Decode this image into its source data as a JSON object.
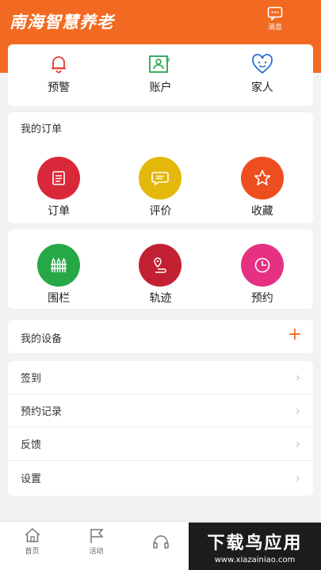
{
  "header": {
    "title": "南海智慧养老",
    "message_label": "消息",
    "message_icon": "chat-bubble-icon",
    "background": "#f26a22"
  },
  "top_actions": [
    {
      "label": "预警",
      "icon": "bell-icon",
      "color": "#e23b2e"
    },
    {
      "label": "账户",
      "icon": "account-card-icon",
      "color": "#27a54a"
    },
    {
      "label": "家人",
      "icon": "smile-heart-icon",
      "color": "#2b6fd6"
    }
  ],
  "orders": {
    "title": "我的订单",
    "items": [
      {
        "label": "订单",
        "icon": "order-list-icon",
        "color": "#d9283a"
      },
      {
        "label": "评价",
        "icon": "comment-icon",
        "color": "#e3b80b"
      },
      {
        "label": "收藏",
        "icon": "star-icon",
        "color": "#ee4d1f"
      }
    ]
  },
  "tools": {
    "items": [
      {
        "label": "围栏",
        "icon": "fence-icon",
        "color": "#27a847"
      },
      {
        "label": "轨迹",
        "icon": "track-icon",
        "color": "#c22033"
      },
      {
        "label": "预约",
        "icon": "clock-icon",
        "color": "#e63183"
      }
    ]
  },
  "device": {
    "title": "我的设备",
    "add_icon": "plus-icon"
  },
  "list": [
    {
      "label": "签到"
    },
    {
      "label": "预约记录"
    },
    {
      "label": "反馈"
    },
    {
      "label": "设置"
    }
  ],
  "bottom_nav": [
    {
      "label": "首页",
      "icon": "home-icon"
    },
    {
      "label": "活动",
      "icon": "flag-icon"
    },
    {
      "label": "",
      "icon": "headset-icon"
    }
  ],
  "watermark": {
    "title": "下载鸟应用",
    "url": "www.xiazainiao.com"
  }
}
